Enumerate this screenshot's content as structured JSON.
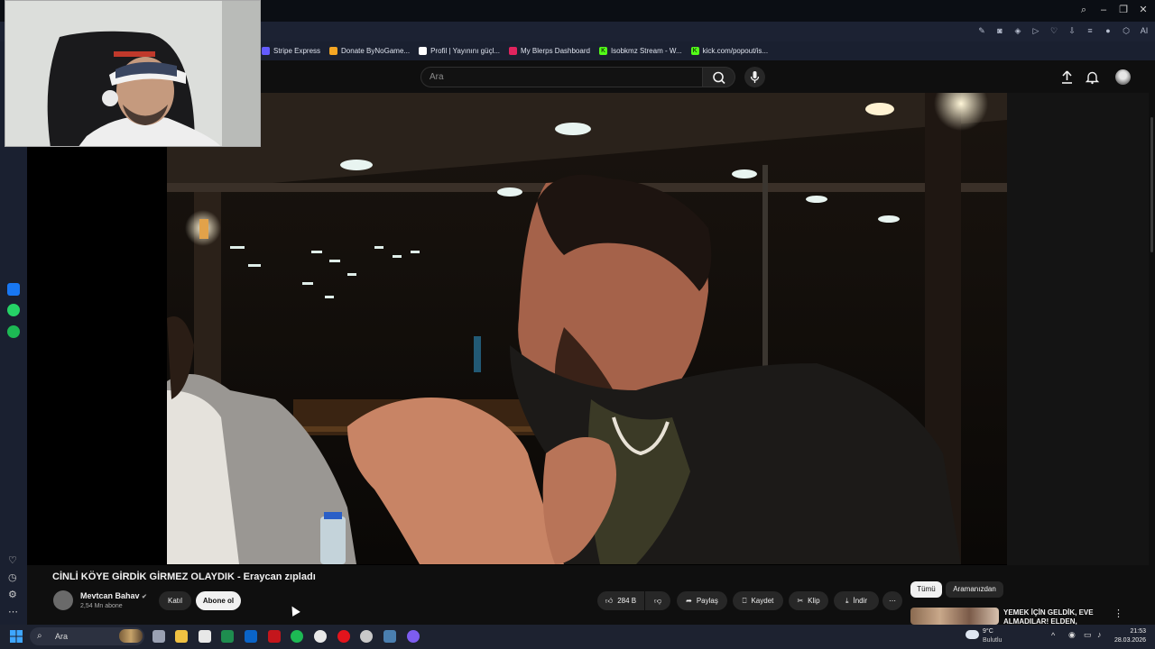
{
  "bookmarks": [
    {
      "label": "Stripe Express",
      "icon": "stripe-icon",
      "color": "#635bff"
    },
    {
      "label": "Donate ByNoGame...",
      "icon": "bynogame-icon",
      "color": "#f5a623"
    },
    {
      "label": "Profil | Yayınını güçl...",
      "icon": "profile-icon",
      "color": "#ffffff"
    },
    {
      "label": "My Blerps Dashboard",
      "icon": "blerp-icon",
      "color": "#e0245e"
    },
    {
      "label": "Isobkmz Stream - W...",
      "icon": "kick-icon",
      "color": "#53fc18"
    },
    {
      "label": "kick.com/popout/is...",
      "icon": "kick-icon",
      "color": "#53fc18"
    }
  ],
  "browser": {
    "ai_label": "AI"
  },
  "header": {
    "search_placeholder": "Ara"
  },
  "video": {
    "title": "CİNLİ KÖYE GİRDİK GİRMEZ OLAYDIK - Eraycan zıpladı",
    "channel_name": "Mevtcan Bahav",
    "subscribers": "2,54 Mn abone",
    "join_label": "Katıl",
    "subscribe_label": "Abone ol",
    "likes": "284 B",
    "share_label": "Paylaş",
    "save_label": "Kaydet",
    "clip_label": "Klip",
    "download_label": "İndir"
  },
  "recommendations": {
    "chips": [
      "Tümü",
      "Aramanızdan"
    ],
    "first_title": "YEMEK İÇİN GELDİK, EVE ALMADILAR! ELDEN, ERAY..."
  },
  "taskbar": {
    "search_label": "Ara",
    "weather_temp": "9°C",
    "weather_desc": "Bulutlu",
    "time": "21:53",
    "date": "28.03.2026"
  }
}
